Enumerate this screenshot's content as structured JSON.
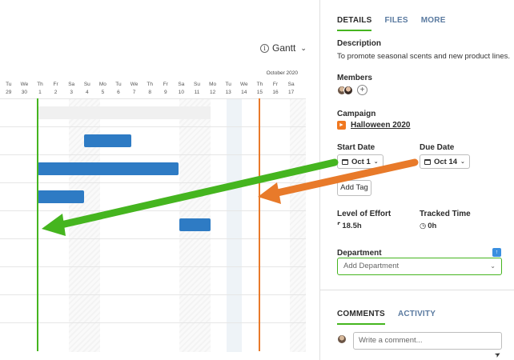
{
  "gantt": {
    "view_label": "Gantt",
    "month_label": "October 2020",
    "days": [
      {
        "dow": "Tu",
        "num": "29"
      },
      {
        "dow": "We",
        "num": "30"
      },
      {
        "dow": "Th",
        "num": "1"
      },
      {
        "dow": "Fr",
        "num": "2"
      },
      {
        "dow": "Sa",
        "num": "3"
      },
      {
        "dow": "Su",
        "num": "4"
      },
      {
        "dow": "Mo",
        "num": "5"
      },
      {
        "dow": "Tu",
        "num": "6"
      },
      {
        "dow": "We",
        "num": "7"
      },
      {
        "dow": "Th",
        "num": "8"
      },
      {
        "dow": "Fr",
        "num": "9"
      },
      {
        "dow": "Sa",
        "num": "10"
      },
      {
        "dow": "Su",
        "num": "11"
      },
      {
        "dow": "Mo",
        "num": "12"
      },
      {
        "dow": "Tu",
        "num": "13"
      },
      {
        "dow": "We",
        "num": "14"
      },
      {
        "dow": "Th",
        "num": "15"
      },
      {
        "dow": "Fr",
        "num": "16"
      },
      {
        "dow": "Sa",
        "num": "17"
      }
    ]
  },
  "details": {
    "tabs": [
      "DETAILS",
      "FILES",
      "MORE"
    ],
    "description_title": "Description",
    "description_text": "To promote seasonal scents and new product lines.",
    "members_title": "Members",
    "campaign_title": "Campaign",
    "campaign_name": "Halloween 2020",
    "start_date_title": "Start Date",
    "start_date_value": "Oct 1",
    "due_date_title": "Due Date",
    "due_date_value": "Oct 14",
    "add_tag_label": "Add Tag",
    "effort_title": "Level of Effort",
    "effort_value": "18.5h",
    "tracked_title": "Tracked Time",
    "tracked_value": "0h",
    "department_title": "Department",
    "department_placeholder": "Add Department",
    "comment_tabs": [
      "COMMENTS",
      "ACTIVITY"
    ],
    "comment_placeholder": "Write a comment..."
  },
  "colors": {
    "start_marker": "#45b51f",
    "due_marker": "#e87a2a",
    "bar": "#2e7bc4",
    "campaign_icon": "#f07820"
  }
}
